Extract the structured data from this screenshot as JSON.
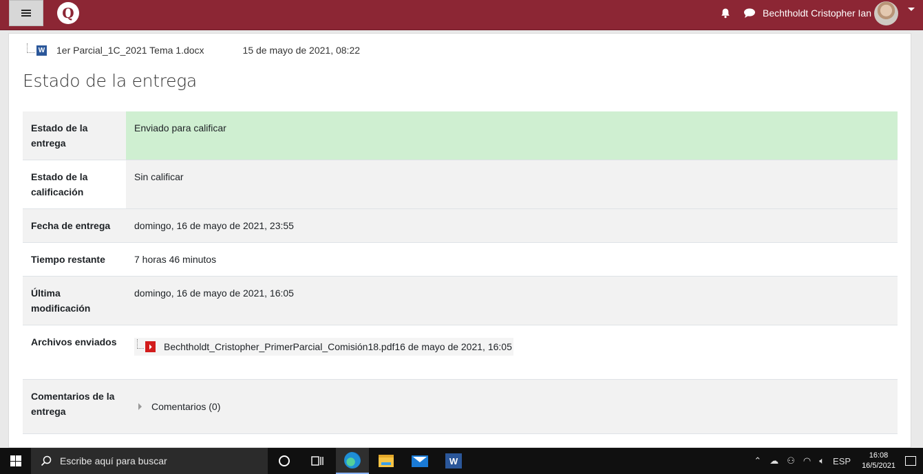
{
  "navbar": {
    "logo_text": "Q",
    "username": "Bechtholdt Cristopher Ian",
    "icons": [
      "menu-icon",
      "bell-icon",
      "chat-icon",
      "caret-down-icon"
    ],
    "brand_color": "#8c2634"
  },
  "attached_file": {
    "name": "1er Parcial_1C_2021 Tema 1.docx",
    "date": "15 de mayo de 2021, 08:22",
    "icon": "word-icon"
  },
  "section_title": "Estado de la entrega",
  "status_table": {
    "submission_status": {
      "label": "Estado de la entrega",
      "value": "Enviado para calificar"
    },
    "grading_status": {
      "label": "Estado de la calificación",
      "value": "Sin calificar"
    },
    "due_date": {
      "label": "Fecha de entrega",
      "value": "domingo, 16 de mayo de 2021, 23:55"
    },
    "time_remaining": {
      "label": "Tiempo restante",
      "value": "7 horas 46 minutos"
    },
    "last_modified": {
      "label": "Última modificación",
      "value": "domingo, 16 de mayo de 2021, 16:05"
    },
    "files": {
      "label": "Archivos enviados",
      "file_name": "Bechtholdt_Cristopher_PrimerParcial_Comisión18.pdf",
      "file_date": "16 de mayo de 2021, 16:05"
    },
    "comments": {
      "label": "Comentarios de la entrega",
      "link": "Comentarios (0)"
    }
  },
  "taskbar": {
    "search_placeholder": "Escribe aquí para buscar",
    "language": "ESP",
    "time": "16:08",
    "date": "16/5/2021"
  }
}
